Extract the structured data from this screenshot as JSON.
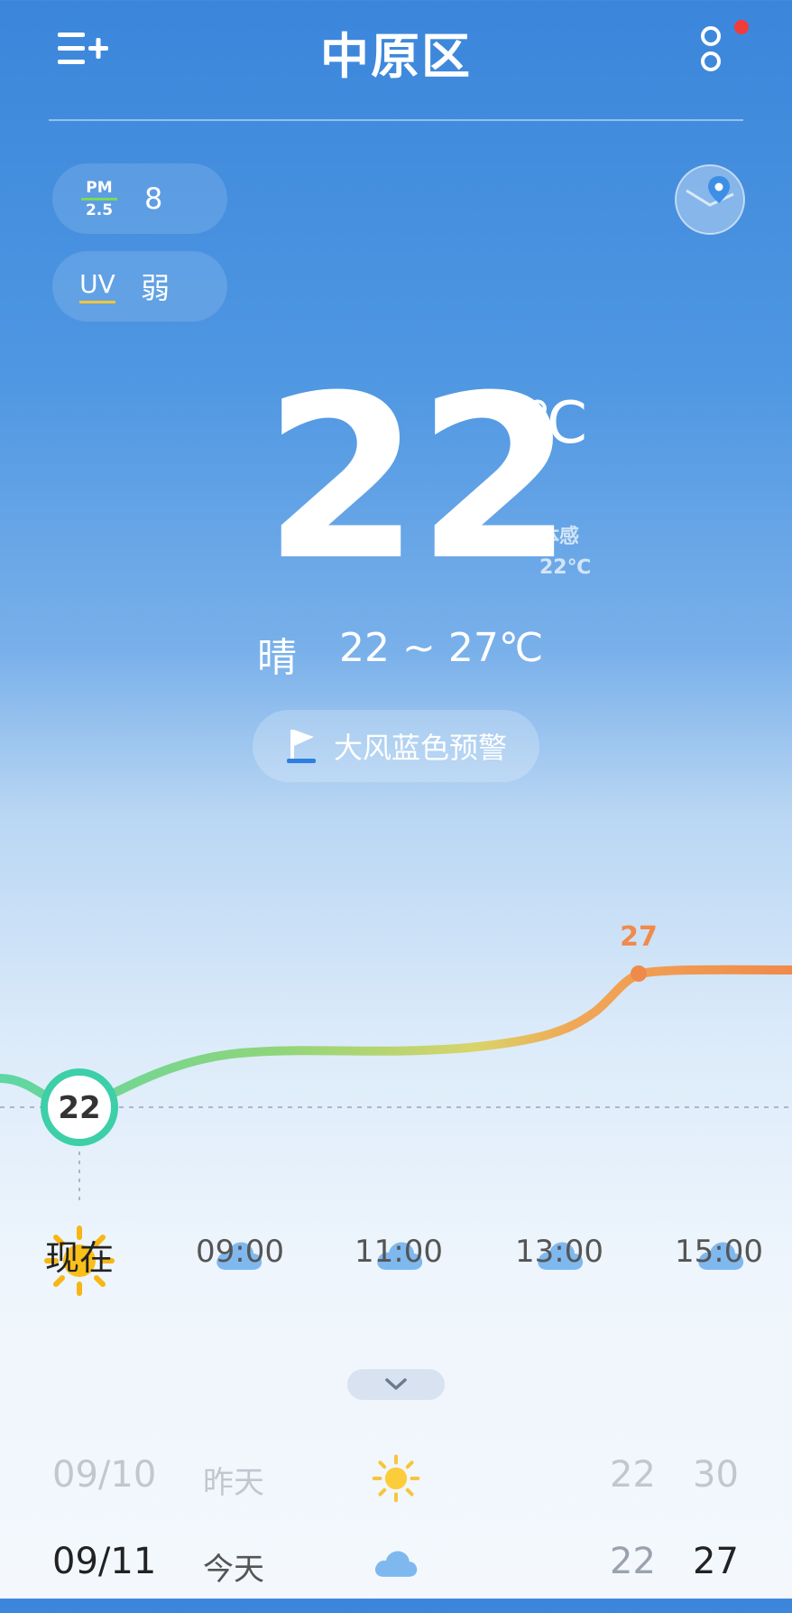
{
  "header": {
    "title": "中原区"
  },
  "air": {
    "pm_label_top": "PM",
    "pm_label_bottom": "2.5",
    "pm_value": "8",
    "uv_label": "UV",
    "uv_value": "弱"
  },
  "current": {
    "temp": "22",
    "unit": "℃",
    "feels_label": "体感",
    "feels_value": "22℃",
    "condition": "晴",
    "range": "22 ~ 27℃"
  },
  "alert": {
    "text": "大风蓝色预警"
  },
  "hourly_chart": {
    "now_value": "22",
    "peak_value": "27",
    "hours": [
      {
        "label": "现在",
        "icon": "sun-icon"
      },
      {
        "label": "09:00",
        "icon": "cloud-icon"
      },
      {
        "label": "11:00",
        "icon": "cloud-icon"
      },
      {
        "label": "13:00",
        "icon": "cloud-icon"
      },
      {
        "label": "15:00",
        "icon": "cloud-icon"
      }
    ]
  },
  "daily": [
    {
      "date": "09/10",
      "day": "昨天",
      "icon": "sun-icon",
      "low": "22",
      "high": "30"
    },
    {
      "date": "09/11",
      "day": "今天",
      "icon": "cloud-icon",
      "low": "22",
      "high": "27"
    }
  ],
  "colors": {
    "accent_teal": "#3ccfa8",
    "warm_orange": "#f08a4b",
    "alert_flag_blue": "#2f7fe0"
  }
}
